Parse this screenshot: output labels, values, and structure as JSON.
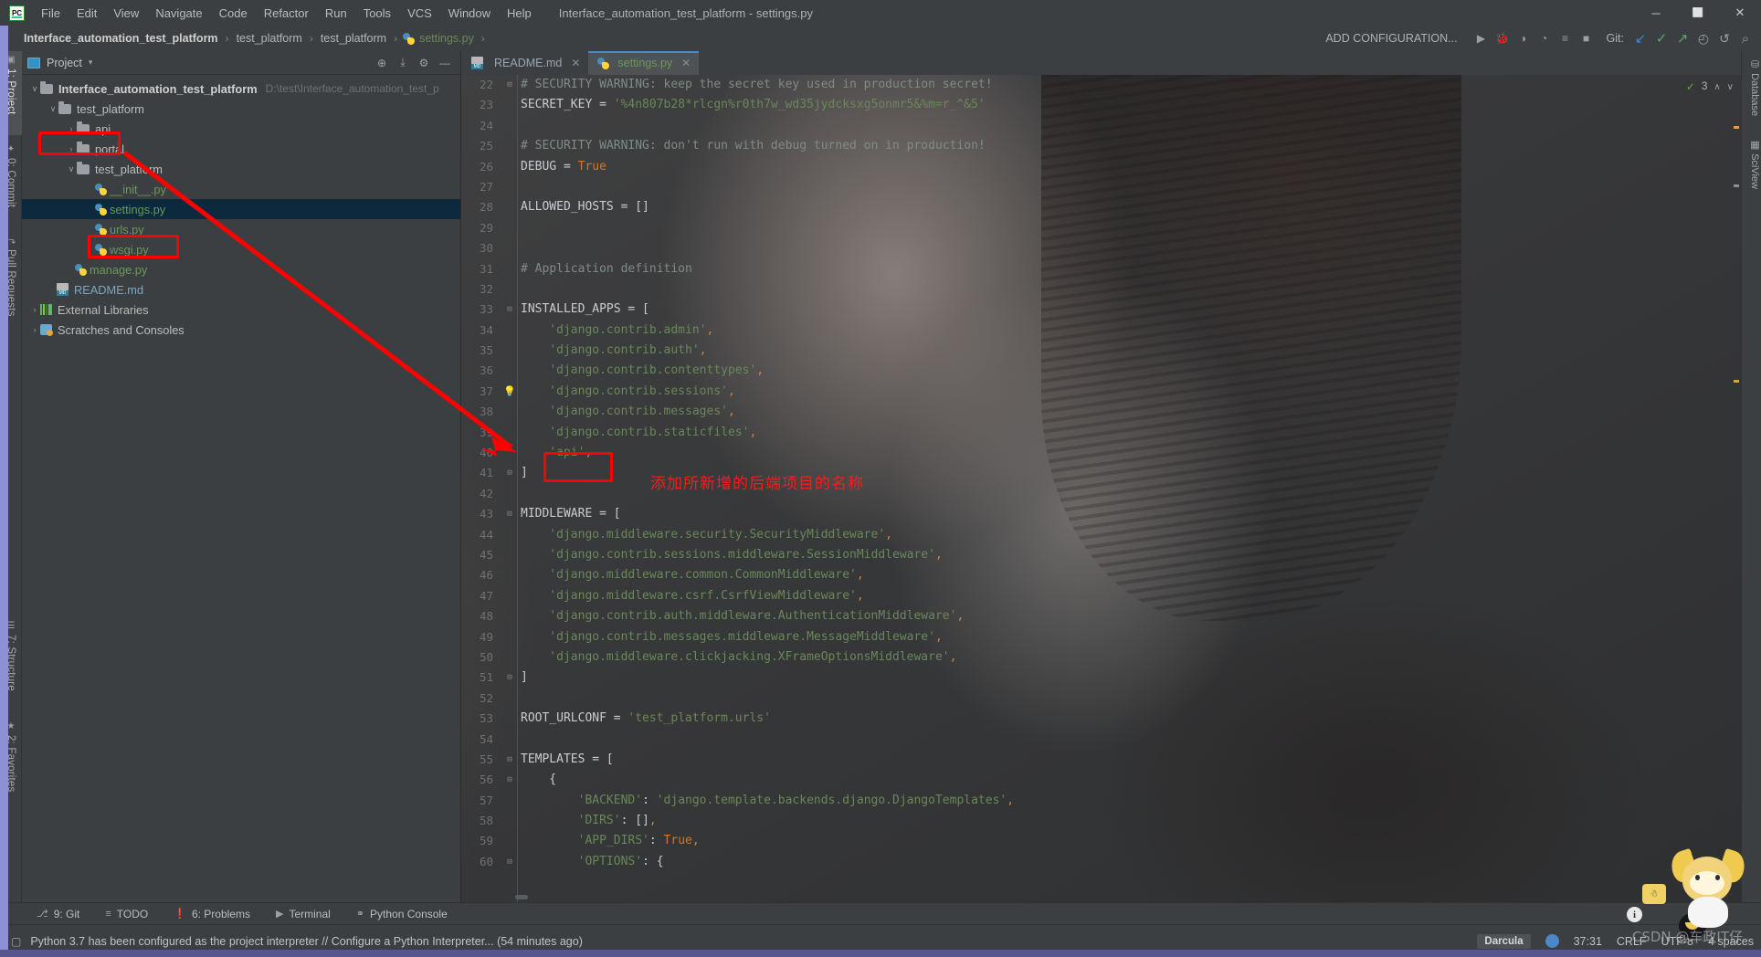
{
  "window": {
    "title": "Interface_automation_test_platform - settings.py",
    "logo_text": "PC",
    "minimize": "─",
    "maximize": "⬜",
    "close": "✕"
  },
  "menu": {
    "items": [
      {
        "label": "File"
      },
      {
        "label": "Edit"
      },
      {
        "label": "View"
      },
      {
        "label": "Navigate"
      },
      {
        "label": "Code"
      },
      {
        "label": "Refactor"
      },
      {
        "label": "Run"
      },
      {
        "label": "Tools"
      },
      {
        "label": "VCS"
      },
      {
        "label": "Window"
      },
      {
        "label": "Help"
      }
    ]
  },
  "breadcrumb": {
    "items": [
      {
        "label": "Interface_automation_test_platform",
        "style": "bold"
      },
      {
        "label": "test_platform",
        "style": "plain"
      },
      {
        "label": "test_platform",
        "style": "plain"
      },
      {
        "label": "settings.py",
        "style": "green"
      }
    ],
    "separator": "›"
  },
  "toolbar": {
    "add_configuration": "ADD CONFIGURATION...",
    "run_icon": "▶",
    "debug_icon": "🐞",
    "coverage_icon": "◑",
    "profile_icon": "◔",
    "run_multi_icon": "≡",
    "stop_icon": "■",
    "git_label": "Git:",
    "git_update_icon": "↙",
    "git_commit_icon": "✓",
    "git_push_icon": "↗",
    "history_icon": "◴",
    "rollback_icon": "↺",
    "search_icon": "⌕"
  },
  "left_tool_tabs": [
    {
      "label": "1: Project",
      "icon": "▣",
      "active": true
    },
    {
      "label": "0: Commit",
      "icon": "✦",
      "active": false
    },
    {
      "label": "Pull Requests",
      "icon": "↱",
      "active": false
    },
    {
      "label": "7: Structure",
      "icon": "☰",
      "active": false
    },
    {
      "label": "2: Favorites",
      "icon": "★",
      "active": false
    }
  ],
  "right_tool_tabs": [
    {
      "label": "Database",
      "icon": "⛁"
    },
    {
      "label": "SciView",
      "icon": "▦"
    }
  ],
  "project_panel": {
    "title": "Project",
    "caret": "▾",
    "locate_icon": "⊕",
    "collapse_icon": "⤓",
    "hide_icon": "—",
    "tree": [
      {
        "indent": 0,
        "arrow": "∨",
        "type": "folder",
        "label": "Interface_automation_test_platform",
        "style": "bold",
        "path": "D:\\test\\Interface_automation_test_p"
      },
      {
        "indent": 1,
        "arrow": "∨",
        "type": "folder",
        "label": "test_platform",
        "style": "plain",
        "path": ""
      },
      {
        "indent": 2,
        "arrow": "›",
        "type": "folder",
        "label": "api",
        "style": "plain",
        "path": ""
      },
      {
        "indent": 2,
        "arrow": "›",
        "type": "folder",
        "label": "portal",
        "style": "plain",
        "path": ""
      },
      {
        "indent": 2,
        "arrow": "∨",
        "type": "folder",
        "label": "test_platform",
        "style": "plain",
        "path": ""
      },
      {
        "indent": 3,
        "arrow": "",
        "type": "python",
        "label": "__init__.py",
        "style": "green",
        "path": ""
      },
      {
        "indent": 3,
        "arrow": "",
        "type": "python",
        "label": "settings.py",
        "style": "green",
        "path": "",
        "selected": true
      },
      {
        "indent": 3,
        "arrow": "",
        "type": "python",
        "label": "urls.py",
        "style": "green",
        "path": ""
      },
      {
        "indent": 3,
        "arrow": "",
        "type": "python",
        "label": "wsgi.py",
        "style": "green",
        "path": ""
      },
      {
        "indent": 2,
        "arrow": "",
        "type": "python",
        "label": "manage.py",
        "style": "green",
        "path": ""
      },
      {
        "indent": 1,
        "arrow": "",
        "type": "markdown",
        "label": "README.md",
        "style": "blue",
        "path": ""
      },
      {
        "indent": 0,
        "arrow": "›",
        "type": "library",
        "label": "External Libraries",
        "style": "plain",
        "path": ""
      },
      {
        "indent": 0,
        "arrow": "›",
        "type": "scratch",
        "label": "Scratches and Consoles",
        "style": "plain",
        "path": ""
      }
    ]
  },
  "editor": {
    "tabs": [
      {
        "label": "README.md",
        "type": "markdown",
        "active": false,
        "close": "✕"
      },
      {
        "label": "settings.py",
        "type": "python",
        "active": true,
        "close": "✕"
      }
    ],
    "inspection": {
      "count": "3",
      "check": "✓",
      "up": "∧",
      "down": "∨"
    },
    "first_line_number": 22,
    "lines": [
      {
        "n": 22,
        "fold": "⊟",
        "tokens": [
          {
            "t": "# SECURITY WARNING: keep the secret key used in production secret!",
            "c": "c-com"
          }
        ]
      },
      {
        "n": 23,
        "fold": "",
        "tokens": [
          {
            "t": "SECRET_KEY = ",
            "c": "c-txt"
          },
          {
            "t": "'%4n807b28*rlcgn%r0th7w_wd35jydcksxg5onmr5&%m=r_^&5'",
            "c": "c-str"
          }
        ]
      },
      {
        "n": 24,
        "fold": "",
        "tokens": []
      },
      {
        "n": 25,
        "fold": "",
        "tokens": [
          {
            "t": "# SECURITY WARNING: don't run with debug turned on in production!",
            "c": "c-com"
          }
        ]
      },
      {
        "n": 26,
        "fold": "",
        "tokens": [
          {
            "t": "DEBUG = ",
            "c": "c-txt"
          },
          {
            "t": "True",
            "c": "c-kw"
          }
        ]
      },
      {
        "n": 27,
        "fold": "",
        "tokens": []
      },
      {
        "n": 28,
        "fold": "",
        "tokens": [
          {
            "t": "ALLOWED_HOSTS = []",
            "c": "c-txt"
          }
        ]
      },
      {
        "n": 29,
        "fold": "",
        "tokens": []
      },
      {
        "n": 30,
        "fold": "",
        "tokens": []
      },
      {
        "n": 31,
        "fold": "",
        "tokens": [
          {
            "t": "# Application definition",
            "c": "c-com"
          }
        ]
      },
      {
        "n": 32,
        "fold": "",
        "tokens": []
      },
      {
        "n": 33,
        "fold": "⊟",
        "tokens": [
          {
            "t": "INSTALLED_APPS = [",
            "c": "c-txt"
          }
        ]
      },
      {
        "n": 34,
        "fold": "",
        "tokens": [
          {
            "t": "    'django.contrib.admin'",
            "c": "c-str"
          },
          {
            "t": ",",
            "c": "c-punc"
          }
        ]
      },
      {
        "n": 35,
        "fold": "",
        "tokens": [
          {
            "t": "    'django.contrib.auth'",
            "c": "c-str"
          },
          {
            "t": ",",
            "c": "c-punc"
          }
        ]
      },
      {
        "n": 36,
        "fold": "",
        "tokens": [
          {
            "t": "    'django.contrib.contenttypes'",
            "c": "c-str"
          },
          {
            "t": ",",
            "c": "c-punc"
          }
        ]
      },
      {
        "n": 37,
        "fold": "",
        "bulb": true,
        "tokens": [
          {
            "t": "    'django.contrib.sessions'",
            "c": "c-str"
          },
          {
            "t": ",",
            "c": "c-punc"
          }
        ]
      },
      {
        "n": 38,
        "fold": "",
        "tokens": [
          {
            "t": "    'django.contrib.messages'",
            "c": "c-str"
          },
          {
            "t": ",",
            "c": "c-punc"
          }
        ]
      },
      {
        "n": 39,
        "fold": "",
        "tokens": [
          {
            "t": "    'django.contrib.staticfiles'",
            "c": "c-str"
          },
          {
            "t": ",",
            "c": "c-punc"
          }
        ]
      },
      {
        "n": 40,
        "fold": "",
        "tokens": [
          {
            "t": "    'api'",
            "c": "c-str"
          },
          {
            "t": ",",
            "c": "c-punc"
          }
        ]
      },
      {
        "n": 41,
        "fold": "⊟",
        "tokens": [
          {
            "t": "]",
            "c": "c-txt"
          }
        ]
      },
      {
        "n": 42,
        "fold": "",
        "tokens": []
      },
      {
        "n": 43,
        "fold": "⊟",
        "tokens": [
          {
            "t": "MIDDLEWARE = [",
            "c": "c-txt"
          }
        ]
      },
      {
        "n": 44,
        "fold": "",
        "tokens": [
          {
            "t": "    'django.middleware.security.SecurityMiddleware'",
            "c": "c-str"
          },
          {
            "t": ",",
            "c": "c-punc"
          }
        ]
      },
      {
        "n": 45,
        "fold": "",
        "tokens": [
          {
            "t": "    'django.contrib.sessions.middleware.SessionMiddleware'",
            "c": "c-str"
          },
          {
            "t": ",",
            "c": "c-punc"
          }
        ]
      },
      {
        "n": 46,
        "fold": "",
        "tokens": [
          {
            "t": "    'django.middleware.common.CommonMiddleware'",
            "c": "c-str"
          },
          {
            "t": ",",
            "c": "c-punc"
          }
        ]
      },
      {
        "n": 47,
        "fold": "",
        "tokens": [
          {
            "t": "    'django.middleware.csrf.CsrfViewMiddleware'",
            "c": "c-str"
          },
          {
            "t": ",",
            "c": "c-punc"
          }
        ]
      },
      {
        "n": 48,
        "fold": "",
        "tokens": [
          {
            "t": "    'django.contrib.auth.middleware.AuthenticationMiddleware'",
            "c": "c-str"
          },
          {
            "t": ",",
            "c": "c-punc"
          }
        ]
      },
      {
        "n": 49,
        "fold": "",
        "tokens": [
          {
            "t": "    'django.contrib.messages.middleware.MessageMiddleware'",
            "c": "c-str"
          },
          {
            "t": ",",
            "c": "c-punc"
          }
        ]
      },
      {
        "n": 50,
        "fold": "",
        "tokens": [
          {
            "t": "    'django.middleware.clickjacking.XFrameOptionsMiddleware'",
            "c": "c-str"
          },
          {
            "t": ",",
            "c": "c-punc"
          }
        ]
      },
      {
        "n": 51,
        "fold": "⊟",
        "tokens": [
          {
            "t": "]",
            "c": "c-txt"
          }
        ]
      },
      {
        "n": 52,
        "fold": "",
        "tokens": []
      },
      {
        "n": 53,
        "fold": "",
        "tokens": [
          {
            "t": "ROOT_URLCONF = ",
            "c": "c-txt"
          },
          {
            "t": "'test_platform.urls'",
            "c": "c-str"
          }
        ]
      },
      {
        "n": 54,
        "fold": "",
        "tokens": []
      },
      {
        "n": 55,
        "fold": "⊟",
        "tokens": [
          {
            "t": "TEMPLATES = [",
            "c": "c-txt"
          }
        ]
      },
      {
        "n": 56,
        "fold": "⊟",
        "indent_fold": true,
        "tokens": [
          {
            "t": "    {",
            "c": "c-txt"
          }
        ]
      },
      {
        "n": 57,
        "fold": "",
        "tokens": [
          {
            "t": "        'BACKEND'",
            "c": "c-str"
          },
          {
            "t": ": ",
            "c": "c-txt"
          },
          {
            "t": "'django.template.backends.django.DjangoTemplates'",
            "c": "c-str"
          },
          {
            "t": ",",
            "c": "c-punc"
          }
        ]
      },
      {
        "n": 58,
        "fold": "",
        "tokens": [
          {
            "t": "        'DIRS'",
            "c": "c-str"
          },
          {
            "t": ": []",
            "c": "c-txt"
          },
          {
            "t": ",",
            "c": "c-punc"
          }
        ]
      },
      {
        "n": 59,
        "fold": "",
        "tokens": [
          {
            "t": "        'APP_DIRS'",
            "c": "c-str"
          },
          {
            "t": ": ",
            "c": "c-txt"
          },
          {
            "t": "True",
            "c": "c-kw"
          },
          {
            "t": ",",
            "c": "c-punc"
          }
        ]
      },
      {
        "n": 60,
        "fold": "⊟",
        "tokens": [
          {
            "t": "        'OPTIONS'",
            "c": "c-str"
          },
          {
            "t": ": {",
            "c": "c-txt"
          }
        ]
      }
    ]
  },
  "annotations": {
    "note_text": "添加所新增的后端项目的名称",
    "color": "#ff0000"
  },
  "tool_windows": [
    {
      "label": "9: Git",
      "icon": "⎇",
      "underline_prefix": "9"
    },
    {
      "label": "TODO",
      "icon": "≡",
      "underline_prefix": ""
    },
    {
      "label": "6: Problems",
      "icon": "❗",
      "underline_prefix": "6"
    },
    {
      "label": "Terminal",
      "icon": "▶",
      "underline_prefix": ""
    },
    {
      "label": "Python Console",
      "icon": "⚭",
      "underline_prefix": ""
    }
  ],
  "status_bar": {
    "icon": "▢",
    "message": "Python 3.7 has been configured as the project interpreter // Configure a Python Interpreter... (54 minutes ago)",
    "theme": "Darcula",
    "cursor_position": "37:31",
    "line_separator": "CRLF",
    "encoding": "UTF-8",
    "indent": "4 spaces",
    "info_badge": "i",
    "watermark": "CSDN @车政IT仔"
  }
}
